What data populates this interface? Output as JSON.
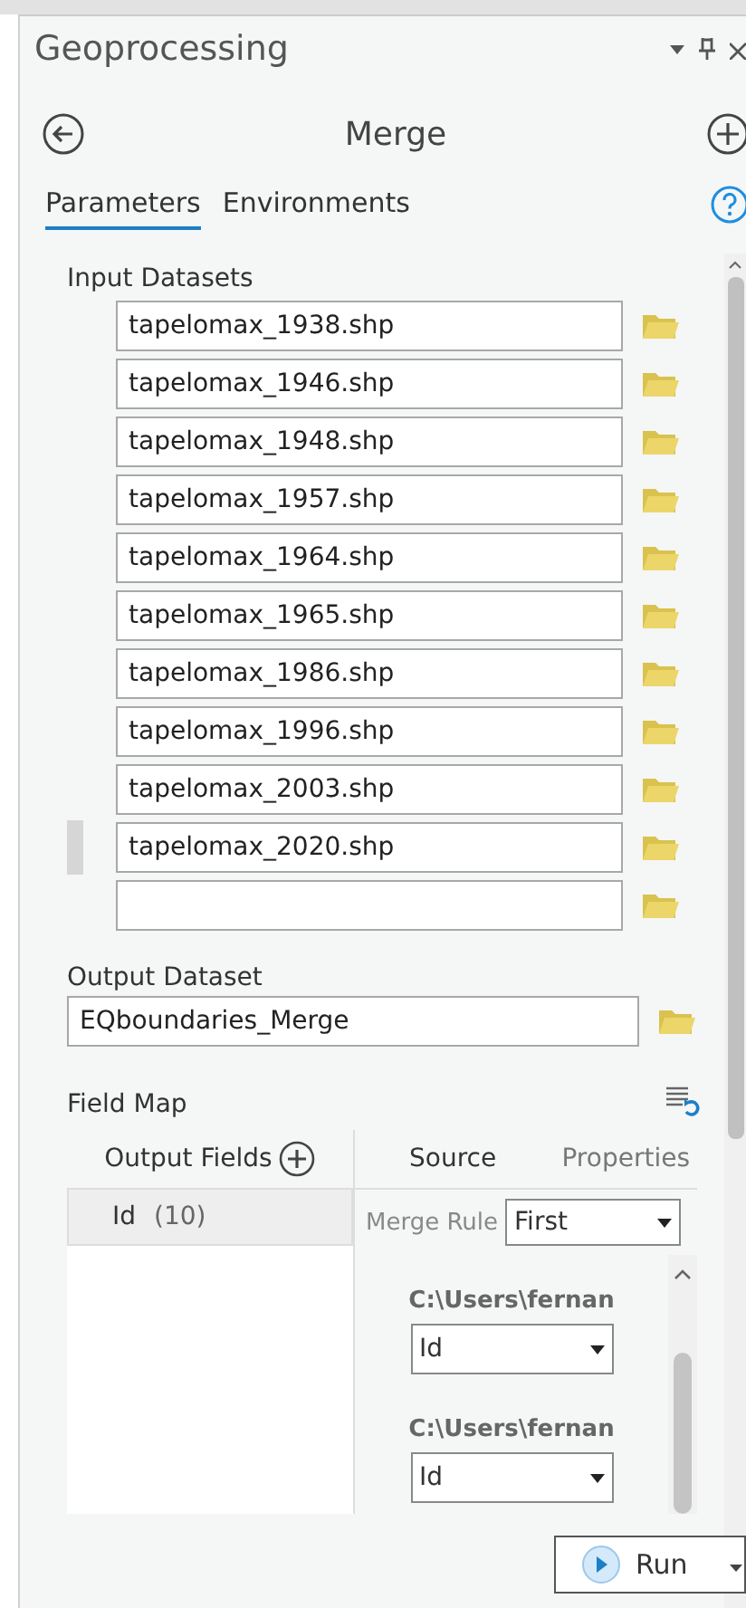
{
  "pane": {
    "title": "Geoprocessing"
  },
  "tool": {
    "title": "Merge"
  },
  "tabs": [
    {
      "label": "Parameters",
      "selected": true
    },
    {
      "label": "Environments",
      "selected": false
    }
  ],
  "input_datasets": {
    "label": "Input Datasets",
    "rows": [
      {
        "value": "tapelomax_1938.shp",
        "selected": false
      },
      {
        "value": "tapelomax_1946.shp",
        "selected": false
      },
      {
        "value": "tapelomax_1948.shp",
        "selected": false
      },
      {
        "value": "tapelomax_1957.shp",
        "selected": false
      },
      {
        "value": "tapelomax_1964.shp",
        "selected": false
      },
      {
        "value": "tapelomax_1965.shp",
        "selected": false
      },
      {
        "value": "tapelomax_1986.shp",
        "selected": false
      },
      {
        "value": "tapelomax_1996.shp",
        "selected": false
      },
      {
        "value": "tapelomax_2003.shp",
        "selected": false
      },
      {
        "value": "tapelomax_2020.shp",
        "selected": true
      },
      {
        "selected": false
      }
    ]
  },
  "output_dataset": {
    "label": "Output Dataset",
    "value": "EQboundaries_Merge"
  },
  "field_map": {
    "label": "Field Map",
    "output_fields_label": "Output Fields",
    "output_fields": [
      {
        "name": "Id",
        "length": "(10)",
        "selected": true
      }
    ],
    "tabs": [
      {
        "label": "Source",
        "selected": true
      },
      {
        "label": "Properties",
        "selected": false
      }
    ],
    "merge_rule": {
      "label": "Merge Rule",
      "value": "First"
    },
    "sources": [
      {
        "path": "C:\\Users\\fernan",
        "field": "Id"
      },
      {
        "path": "C:\\Users\\fernan",
        "field": "Id"
      }
    ]
  },
  "run_button": {
    "label": "Run"
  }
}
